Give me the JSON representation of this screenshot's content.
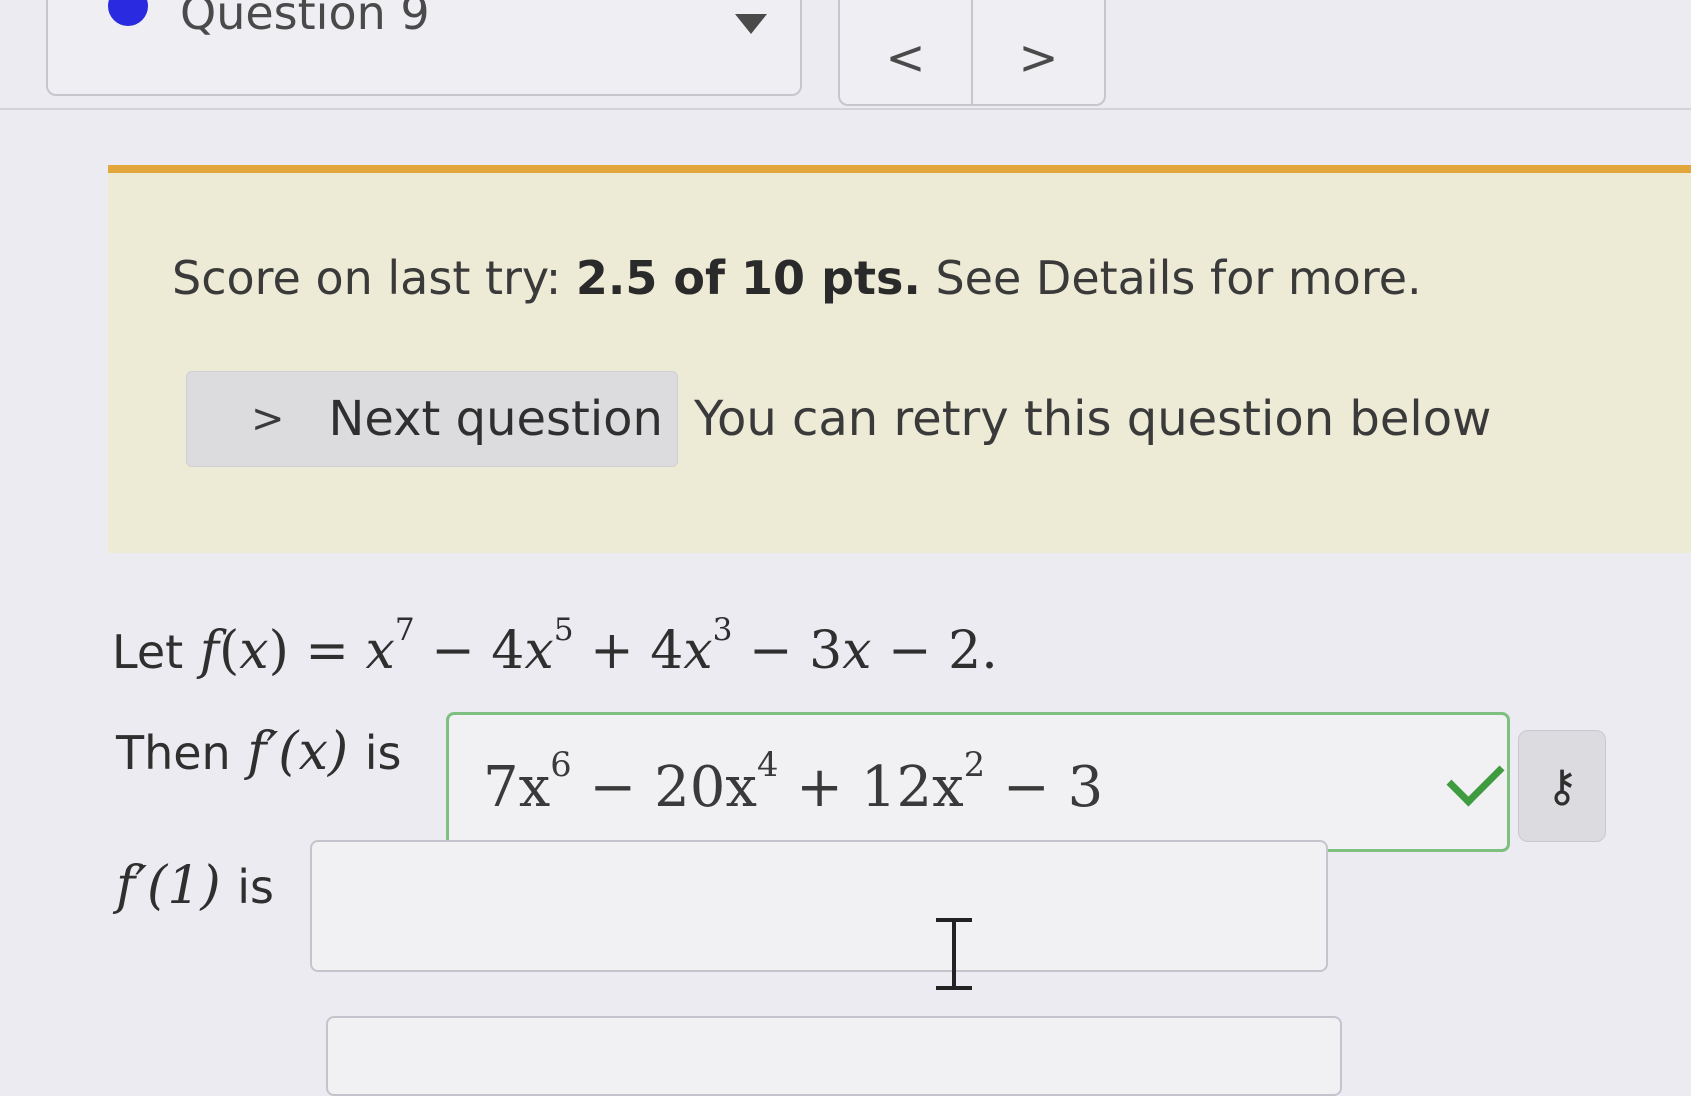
{
  "nav": {
    "question_label": "Question 9",
    "prev_label": "<",
    "next_label": ">"
  },
  "banner": {
    "score_prefix": "Score on last try: ",
    "score_value": "2.5 of 10 pts.",
    "score_suffix": " See Details for more.",
    "next_button_label": "Next question",
    "retry_text": "You can retry this question below"
  },
  "problem": {
    "let_text": "Let",
    "function": "f(x) = x7 − 4x5 + 4x3 − 3x − 2.",
    "then_text": "Then",
    "derivative_label": "f′(x)",
    "is_text": "is",
    "derivative_answer": "7x6 − 20x4 + 12x2 − 3",
    "answer1_status": "correct",
    "f1_label": "f′(1)",
    "f1_is_text": "is",
    "f1_answer": ""
  },
  "colors": {
    "banner_bg": "#edead6",
    "banner_accent": "#e2a63a",
    "correct": "#3f9b3f",
    "question_dot": "#2a2ae0"
  },
  "icons": {
    "dropdown": "caret-down-icon",
    "prev": "chevron-left-icon",
    "next": "chevron-right-icon",
    "check": "checkmark-icon",
    "key": "key-icon"
  }
}
